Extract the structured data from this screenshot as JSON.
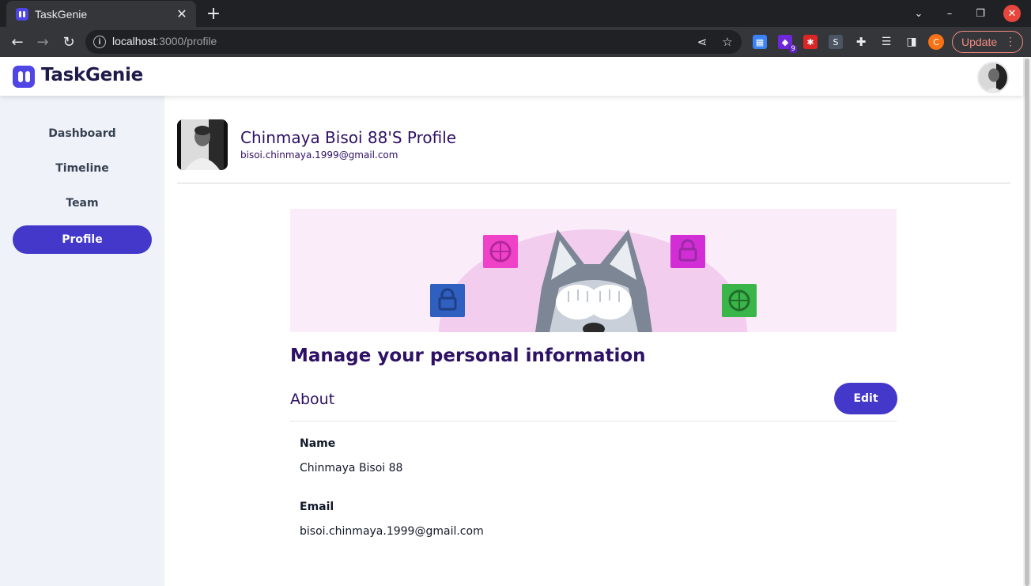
{
  "browser": {
    "tab_title": "TaskGenie",
    "url_host": "localhost",
    "url_path": ":3000/profile",
    "extension_badge": "9",
    "profile_initial": "C",
    "update_label": "Update"
  },
  "app": {
    "brand": "TaskGenie",
    "accent_color": "#4338ca"
  },
  "sidebar": {
    "items": [
      {
        "label": "Dashboard",
        "active": false
      },
      {
        "label": "Timeline",
        "active": false
      },
      {
        "label": "Team",
        "active": false
      },
      {
        "label": "Profile",
        "active": true
      }
    ]
  },
  "profile": {
    "title": "Chinmaya Bisoi 88'S Profile",
    "email": "bisoi.chinmaya.1999@gmail.com"
  },
  "section": {
    "heading": "Manage your personal information",
    "about_title": "About",
    "edit_label": "Edit"
  },
  "fields": [
    {
      "label": "Name",
      "value": "Chinmaya Bisoi 88"
    },
    {
      "label": "Email",
      "value": "bisoi.chinmaya.1999@gmail.com"
    }
  ]
}
